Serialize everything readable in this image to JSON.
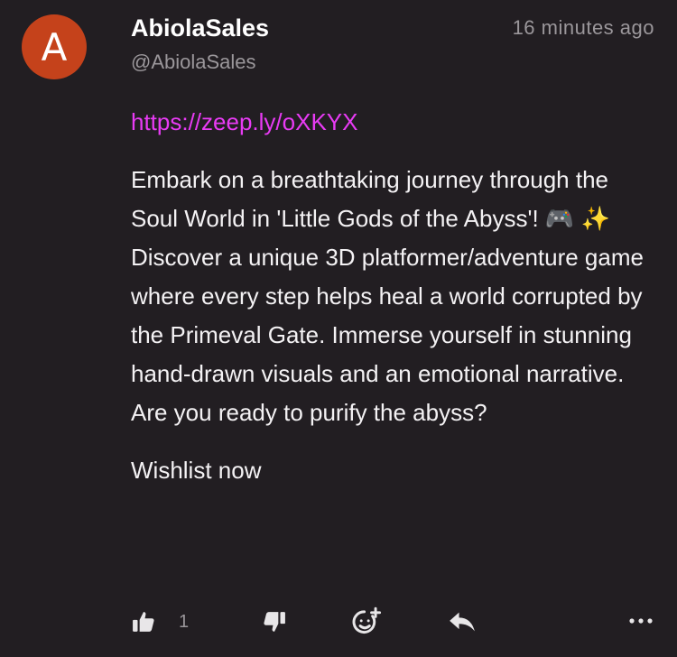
{
  "post": {
    "avatar_letter": "A",
    "avatar_color": "#c5421b",
    "display_name": "AbiolaSales",
    "handle": "@AbiolaSales",
    "timestamp": "16 minutes ago",
    "link": "https://zeep.ly/oXKYX",
    "body": "Embark on a breathtaking journey through the Soul World in 'Little Gods of the Abyss'! 🎮 ✨  Discover a unique 3D platformer/adventure game where every step helps heal a world corrupted by the Primeval Gate. Immerse yourself in stunning hand-drawn visuals and an emotional narrative. Are you ready to purify the abyss?",
    "cta": "Wishlist now",
    "link_color": "#e83bf4"
  },
  "actions": {
    "like_icon": "thumbs-up-icon",
    "like_count": "1",
    "dislike_icon": "thumbs-down-icon",
    "react_icon": "add-reaction-icon",
    "reply_icon": "reply-icon",
    "more_icon": "more-icon"
  }
}
